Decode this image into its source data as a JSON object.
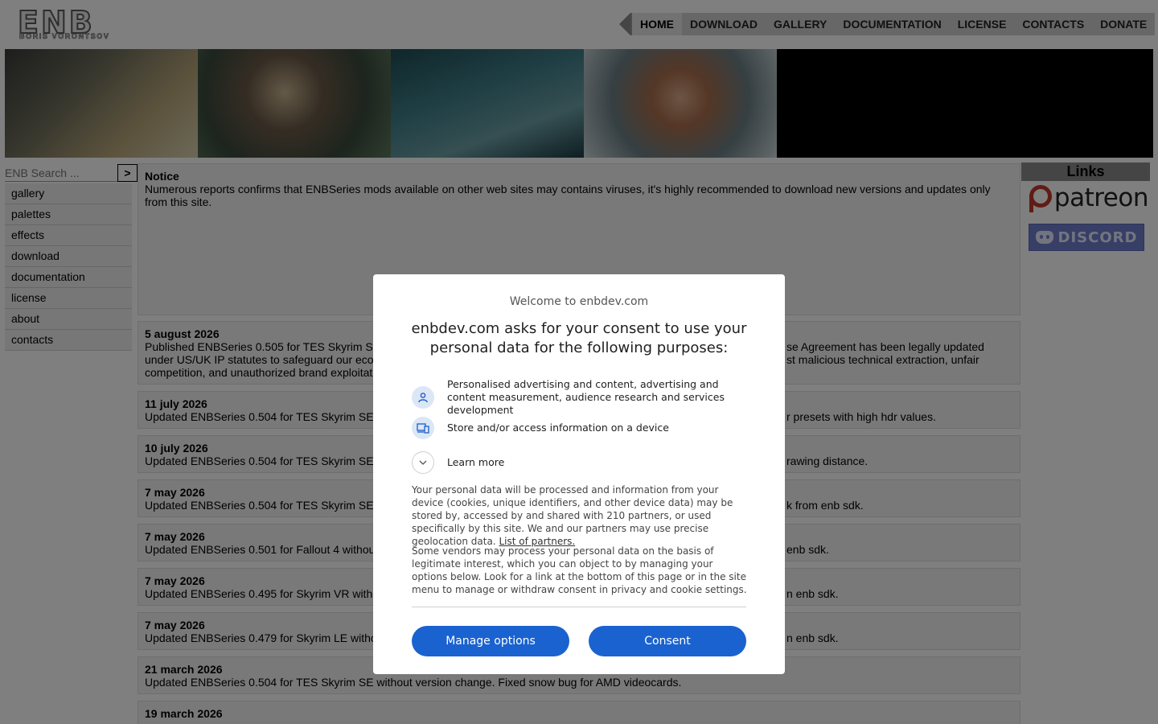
{
  "header": {
    "logo_main": "ENB",
    "logo_sub": "BORIS VORONTSOV",
    "nav": [
      "HOME",
      "DOWNLOAD",
      "GALLERY",
      "DOCUMENTATION",
      "LICENSE",
      "CONTACTS",
      "DONATE"
    ],
    "nav_active": "HOME"
  },
  "sidebar": {
    "search_placeholder": "ENB Search ...",
    "search_button": ">",
    "items": [
      "gallery",
      "palettes",
      "effects",
      "download",
      "documentation",
      "license",
      "about",
      "contacts"
    ]
  },
  "notice": {
    "title": "Notice",
    "text": "Numerous reports confirms that ENBSeries mods available on other web sites may contains viruses, it's highly recommended to download new versions and updates only from this site."
  },
  "news": [
    {
      "date": "5 august 2026",
      "text": "Published ENBSeries 0.505 for TES Skyrim S",
      "text_right": "se Agreement has been legally updated",
      "line2": "under US/UK IP statutes to safeguard our eco",
      "line2_right": "st malicious technical extraction, unfair",
      "line3": "competition, and unauthorized brand exploitati"
    },
    {
      "date": "11 july 2026",
      "text": "Updated ENBSeries 0.504 for TES Skyrim SE",
      "text_right": "r presets with high hdr values."
    },
    {
      "date": "10 july 2026",
      "text": "Updated ENBSeries 0.504 for TES Skyrim SE",
      "text_right": "rawing distance."
    },
    {
      "date": "7 may 2026",
      "text": "Updated ENBSeries 0.504 for TES Skyrim SE",
      "text_right": "k from enb sdk."
    },
    {
      "date": "7 may 2026",
      "text": "Updated ENBSeries 0.501 for Fallout 4 withou",
      "text_right": "enb sdk."
    },
    {
      "date": "7 may 2026",
      "text": "Updated ENBSeries 0.495 for Skyrim VR with",
      "text_right": "n enb sdk."
    },
    {
      "date": "7 may 2026",
      "text": "Updated ENBSeries 0.479 for Skyrim LE witho",
      "text_right": "n enb sdk."
    },
    {
      "date": "21 march 2026",
      "text": "Updated ENBSeries 0.504 for TES Skyrim SE without version change. Fixed snow bug for AMD videocards.",
      "text_right": ""
    },
    {
      "date": "19 march 2026",
      "text": "",
      "text_right": ""
    }
  ],
  "links": {
    "header": "Links",
    "patreon": "patreon",
    "discord": "DISCORD"
  },
  "consent": {
    "welcome": "Welcome to enbdev.com",
    "heading": "enbdev.com asks for your consent to use your personal data for the following purposes:",
    "purposes": [
      {
        "icon": "person-icon",
        "text": "Personalised advertising and content, advertising and content measurement, audience research and services development"
      },
      {
        "icon": "devices-icon",
        "text": "Store and/or access information on a device"
      }
    ],
    "learn_more": "Learn more",
    "para1": "Your personal data will be processed and information from your device (cookies, unique identifiers, and other device data) may be stored by, accessed by and shared with 210 partners, or used specifically by this site. We and our partners may use precise geolocation data.",
    "partners_link": "List of partners.",
    "para2": "Some vendors may process your personal data on the basis of legitimate interest, which you can object to by managing your options below. Look for a link at the bottom of this page or in the site menu to manage or withdraw consent in privacy and cookie settings.",
    "manage_button": "Manage options",
    "consent_button": "Consent",
    "button_color": "#1a62cf"
  }
}
